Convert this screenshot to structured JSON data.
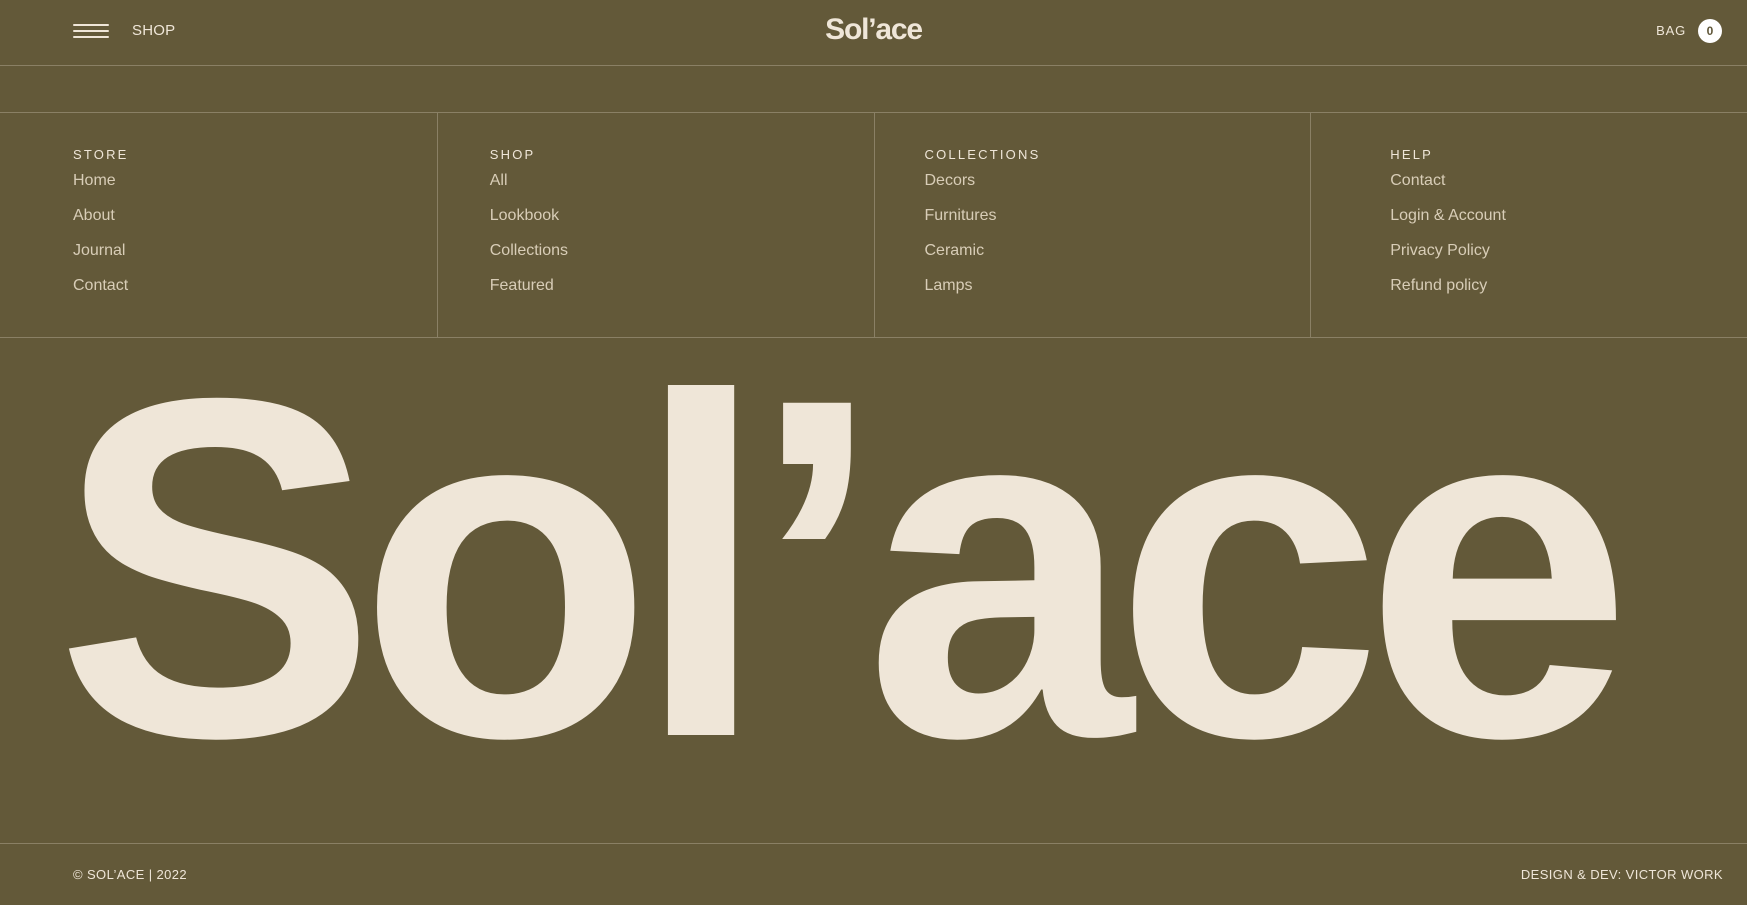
{
  "header": {
    "menu_icon": "hamburger-icon",
    "shop_label": "SHOP",
    "brand": "Sol’ace",
    "bag_label": "BAG",
    "bag_count": "0"
  },
  "footer_nav": {
    "columns": [
      {
        "heading": "STORE",
        "links": [
          "Home",
          "About",
          "Journal",
          "Contact"
        ]
      },
      {
        "heading": "SHOP",
        "links": [
          "All",
          "Lookbook",
          "Collections",
          "Featured"
        ]
      },
      {
        "heading": "COLLECTIONS",
        "links": [
          "Decors",
          "Furnitures",
          "Ceramic",
          "Lamps"
        ]
      },
      {
        "heading": "HELP",
        "links": [
          "Contact",
          "Login & Account",
          "Privacy Policy",
          "Refund policy"
        ]
      }
    ]
  },
  "hero": {
    "wordmark": "Sol’ace"
  },
  "footer": {
    "copyright": "© SOL’ACE | 2022",
    "credit": "DESIGN & DEV: VICTOR WORK"
  },
  "colors": {
    "background": "#635939",
    "text": "#efe6d8",
    "muted_text": "#d8cdb7",
    "badge_bg": "#ffffff",
    "badge_text": "#5f5638"
  }
}
